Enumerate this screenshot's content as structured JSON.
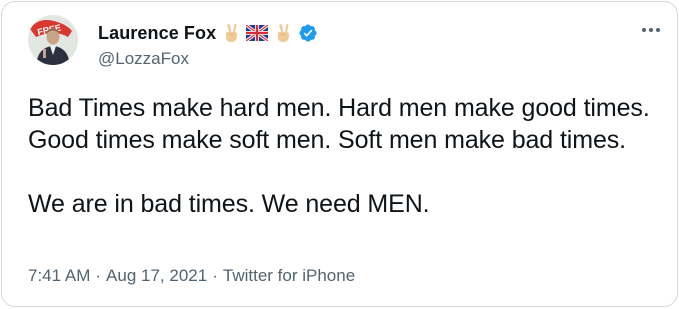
{
  "user": {
    "display_name": "Laurence Fox",
    "handle": "@LozzaFox",
    "name_emojis": [
      "victory-hand-icon",
      "uk-flag-icon",
      "victory-hand-icon"
    ],
    "verified": true,
    "avatar_sign_text": "FREE"
  },
  "tweet": {
    "paragraph_1": "Bad Times make hard men. Hard men make good times. Good times make soft men. Soft men make bad times.",
    "paragraph_2": "We are in bad times. We need MEN."
  },
  "meta": {
    "time": "7:41 AM",
    "separator_1": "·",
    "date": "Aug 17, 2021",
    "separator_2": "·",
    "source": "Twitter for iPhone"
  },
  "colors": {
    "text": "#0f1419",
    "secondary": "#536471",
    "verified_blue": "#1d9bf0",
    "border": "#cfd9de"
  }
}
